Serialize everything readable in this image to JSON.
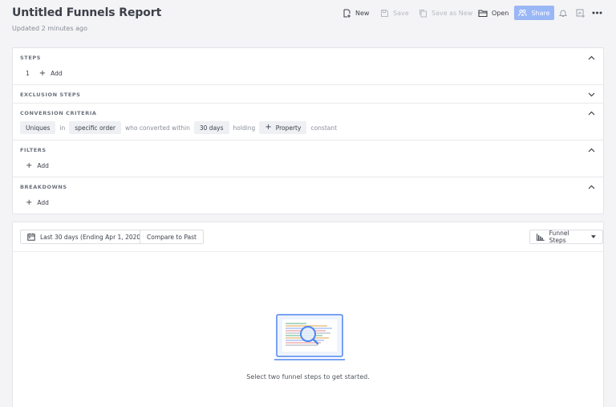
{
  "report": {
    "title": "Untitled Funnels Report",
    "updated": "Updated 2 minutes ago"
  },
  "toolbar": {
    "new": "New",
    "save": "Save",
    "save_as_new": "Save as New",
    "open": "Open",
    "share": "Share"
  },
  "sections": {
    "steps": {
      "label": "STEPS",
      "step_number": "1",
      "add": "Add"
    },
    "exclusion": {
      "label": "EXCLUSION STEPS"
    },
    "conversion": {
      "label": "CONVERSION CRITERIA",
      "uniques": "Uniques",
      "in": "in",
      "order": "specific order",
      "who_converted": "who converted within",
      "window": "30 days",
      "holding": "holding",
      "property": "Property",
      "constant": "constant"
    },
    "filters": {
      "label": "FILTERS",
      "add": "Add"
    },
    "breakdowns": {
      "label": "BREAKDOWNS",
      "add": "Add"
    }
  },
  "results": {
    "date_range": "Last 30 days (Ending Apr 1, 2020)",
    "compare": "Compare to Past",
    "view": "Funnel Steps",
    "empty_message": "Select two funnel steps to get started."
  },
  "colors": {
    "accent": "#4f86f0",
    "share_bg": "#9ab7f5"
  }
}
